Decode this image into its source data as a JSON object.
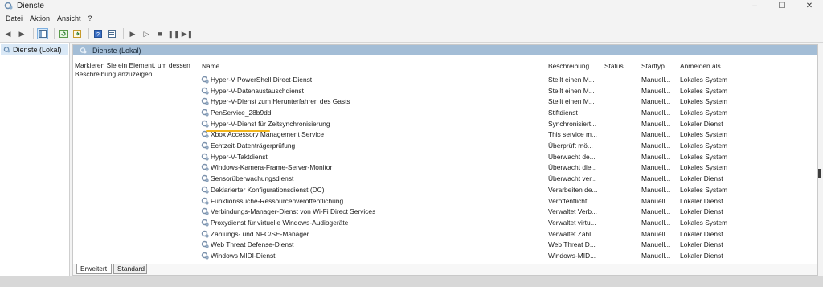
{
  "window": {
    "title": "Dienste",
    "controls": [
      "–",
      "☐",
      "✕"
    ]
  },
  "menu": [
    "Datei",
    "Aktion",
    "Ansicht",
    "?"
  ],
  "tree": {
    "item": "Dienste (Lokal)"
  },
  "panel": {
    "header": "Dienste (Lokal)",
    "description": "Markieren Sie ein Element, um dessen Beschreibung anzuzeigen."
  },
  "columns": {
    "name": "Name",
    "description": "Beschreibung",
    "status": "Status",
    "startup": "Starttyp",
    "logon": "Anmelden als"
  },
  "rows": [
    {
      "name": "Hyper-V PowerShell Direct-Dienst",
      "description": "Stellt einen M...",
      "startup": "Manuell...",
      "logon": "Lokales System"
    },
    {
      "name": "Hyper-V-Datenaustauschdienst",
      "description": "Stellt einen M...",
      "startup": "Manuell...",
      "logon": "Lokales System"
    },
    {
      "name": "Hyper-V-Dienst zum Herunterfahren des Gasts",
      "description": "Stellt einen M...",
      "startup": "Manuell...",
      "logon": "Lokales System"
    },
    {
      "name": "PenService_28b9dd",
      "description": "Stiftdienst",
      "startup": "Manuell...",
      "logon": "Lokales System"
    },
    {
      "name": "Hyper-V-Dienst für Zeitsynchronisierung",
      "description": "Synchronisiert...",
      "startup": "Manuell...",
      "logon": "Lokaler Dienst"
    },
    {
      "name": "Xbox Accessory Management Service",
      "description": "This service m...",
      "startup": "Manuell...",
      "logon": "Lokales System"
    },
    {
      "name": "Echtzeit-Datenträgerprüfung",
      "description": "Überprüft mö...",
      "startup": "Manuell...",
      "logon": "Lokales System"
    },
    {
      "name": "Hyper-V-Taktdienst",
      "description": "Überwacht de...",
      "startup": "Manuell...",
      "logon": "Lokales System"
    },
    {
      "name": "Windows-Kamera-Frame-Server-Monitor",
      "description": "Überwacht die...",
      "startup": "Manuell...",
      "logon": "Lokales System"
    },
    {
      "name": "Sensorüberwachungsdienst",
      "description": "Überwacht ver...",
      "startup": "Manuell...",
      "logon": "Lokaler Dienst"
    },
    {
      "name": "Deklarierter Konfigurationsdienst (DC)",
      "description": "Verarbeiten de...",
      "startup": "Manuell...",
      "logon": "Lokales System"
    },
    {
      "name": "Funktionssuche-Ressourcenveröffentlichung",
      "description": "Veröffentlicht ...",
      "startup": "Manuell...",
      "logon": "Lokaler Dienst"
    },
    {
      "name": "Verbindungs-Manager-Dienst von Wi-Fi Direct Services",
      "description": "Verwaltet Verb...",
      "startup": "Manuell...",
      "logon": "Lokaler Dienst"
    },
    {
      "name": "Proxydienst für virtuelle Windows-Audiogeräte",
      "description": "Verwaltet virtu...",
      "startup": "Manuell...",
      "logon": "Lokales System"
    },
    {
      "name": "Zahlungs- und NFC/SE-Manager",
      "description": "Verwaltet Zahl...",
      "startup": "Manuell...",
      "logon": "Lokaler Dienst"
    },
    {
      "name": "Web Threat Defense-Dienst",
      "description": "Web Threat D...",
      "startup": "Manuell...",
      "logon": "Lokaler Dienst"
    },
    {
      "name": "Windows MIDI-Dienst",
      "description": "Windows-MID...",
      "startup": "Manuell...",
      "logon": "Lokaler Dienst"
    }
  ],
  "tabs": [
    "Erweitert",
    "Standard"
  ]
}
